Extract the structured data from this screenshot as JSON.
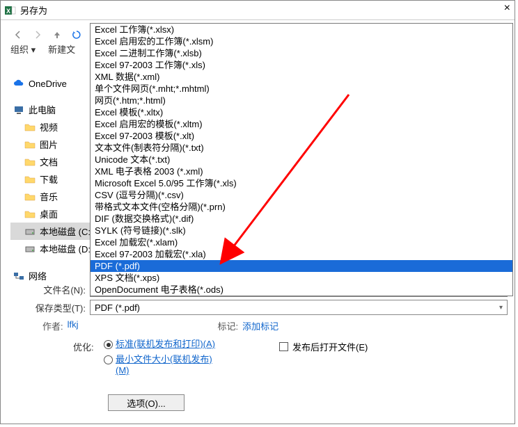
{
  "window": {
    "title": "另存为"
  },
  "toolbar": {
    "organize": "组织 ▾",
    "newfolder": "新建文"
  },
  "sidebar": {
    "items": [
      {
        "icon": "cloud",
        "label": "OneDrive"
      },
      {
        "icon": "pc",
        "label": "此电脑"
      },
      {
        "icon": "folder",
        "label": "视频"
      },
      {
        "icon": "folder",
        "label": "图片"
      },
      {
        "icon": "folder",
        "label": "文档"
      },
      {
        "icon": "folder",
        "label": "下载"
      },
      {
        "icon": "folder",
        "label": "音乐"
      },
      {
        "icon": "folder",
        "label": "桌面"
      },
      {
        "icon": "drive",
        "label": "本地磁盘 (C:)",
        "selected": true
      },
      {
        "icon": "drive",
        "label": "本地磁盘 (D:)"
      },
      {
        "icon": "net",
        "label": "网络"
      }
    ]
  },
  "filetype_options": [
    "Excel 工作簿(*.xlsx)",
    "Excel 启用宏的工作簿(*.xlsm)",
    "Excel 二进制工作簿(*.xlsb)",
    "Excel 97-2003 工作簿(*.xls)",
    "XML 数据(*.xml)",
    "单个文件网页(*.mht;*.mhtml)",
    "网页(*.htm;*.html)",
    "Excel 模板(*.xltx)",
    "Excel 启用宏的模板(*.xltm)",
    "Excel 97-2003 模板(*.xlt)",
    "文本文件(制表符分隔)(*.txt)",
    "Unicode 文本(*.txt)",
    "XML 电子表格 2003 (*.xml)",
    "Microsoft Excel 5.0/95 工作簿(*.xls)",
    "CSV (逗号分隔)(*.csv)",
    "带格式文本文件(空格分隔)(*.prn)",
    "DIF (数据交换格式)(*.dif)",
    "SYLK (符号链接)(*.slk)",
    "Excel 加载宏(*.xlam)",
    "Excel 97-2003 加载宏(*.xla)",
    "PDF (*.pdf)",
    "XPS 文档(*.xps)",
    "OpenDocument 电子表格(*.ods)"
  ],
  "filetype_selected": "PDF (*.pdf)",
  "filename_label": "文件名(N):",
  "filetype_label": "保存类型(T):",
  "filetype_value": "PDF (*.pdf)",
  "meta": {
    "author_label": "作者:",
    "author_value": "lfkj",
    "tags_label": "标记:",
    "tags_value": "添加标记"
  },
  "optimize": {
    "label": "优化:",
    "opt1": "标准(联机发布和打印)(A)",
    "opt2": "最小文件大小(联机发布)(M)"
  },
  "open_after": "发布后打开文件(E)",
  "options_button": "选项(O)..."
}
